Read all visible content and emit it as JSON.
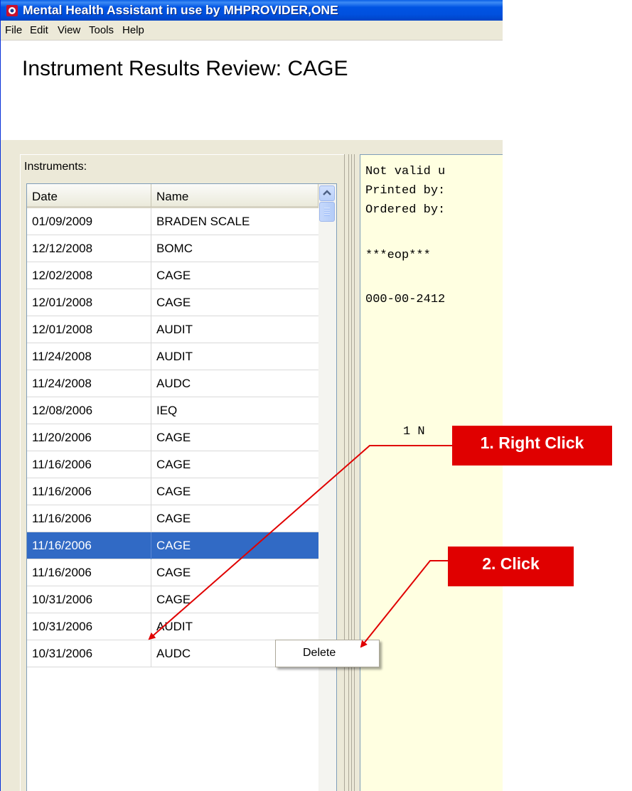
{
  "window": {
    "title": "Mental Health Assistant in use by MHPROVIDER,ONE",
    "icon": "app-icon"
  },
  "menu": [
    "File",
    "Edit",
    "View",
    "Tools",
    "Help"
  ],
  "page_title": "Instrument Results Review: CAGE",
  "instruments": {
    "label": "Instruments:",
    "columns": [
      "Date",
      "Name"
    ],
    "rows": [
      {
        "date": "01/09/2009",
        "name": "BRADEN SCALE"
      },
      {
        "date": "12/12/2008",
        "name": "BOMC"
      },
      {
        "date": "12/02/2008",
        "name": "CAGE"
      },
      {
        "date": "12/01/2008",
        "name": "CAGE"
      },
      {
        "date": "12/01/2008",
        "name": "AUDIT"
      },
      {
        "date": "11/24/2008",
        "name": "AUDIT"
      },
      {
        "date": "11/24/2008",
        "name": "AUDC"
      },
      {
        "date": "12/08/2006",
        "name": "IEQ"
      },
      {
        "date": "11/20/2006",
        "name": "CAGE"
      },
      {
        "date": "11/16/2006",
        "name": "CAGE"
      },
      {
        "date": "11/16/2006",
        "name": "CAGE"
      },
      {
        "date": "11/16/2006",
        "name": "CAGE"
      },
      {
        "date": "11/16/2006",
        "name": "CAGE",
        "selected": true
      },
      {
        "date": "11/16/2006",
        "name": "CAGE"
      },
      {
        "date": "10/31/2006",
        "name": "CAGE"
      },
      {
        "date": "10/31/2006",
        "name": "AUDIT"
      },
      {
        "date": "10/31/2006",
        "name": "AUDC"
      }
    ]
  },
  "report": {
    "lines": [
      "Not valid u",
      "Printed by:",
      "Ordered by:",
      "***eop***",
      "000-00-2412",
      "1 N    2"
    ]
  },
  "context_menu": {
    "items": [
      "Delete"
    ]
  },
  "callouts": {
    "step1": "1. Right Click",
    "step2": "2. Click"
  },
  "colors": {
    "titlebar": "#0054e3",
    "selection": "#316ac5",
    "callout": "#e00000",
    "report_bg": "#ffffe1"
  }
}
